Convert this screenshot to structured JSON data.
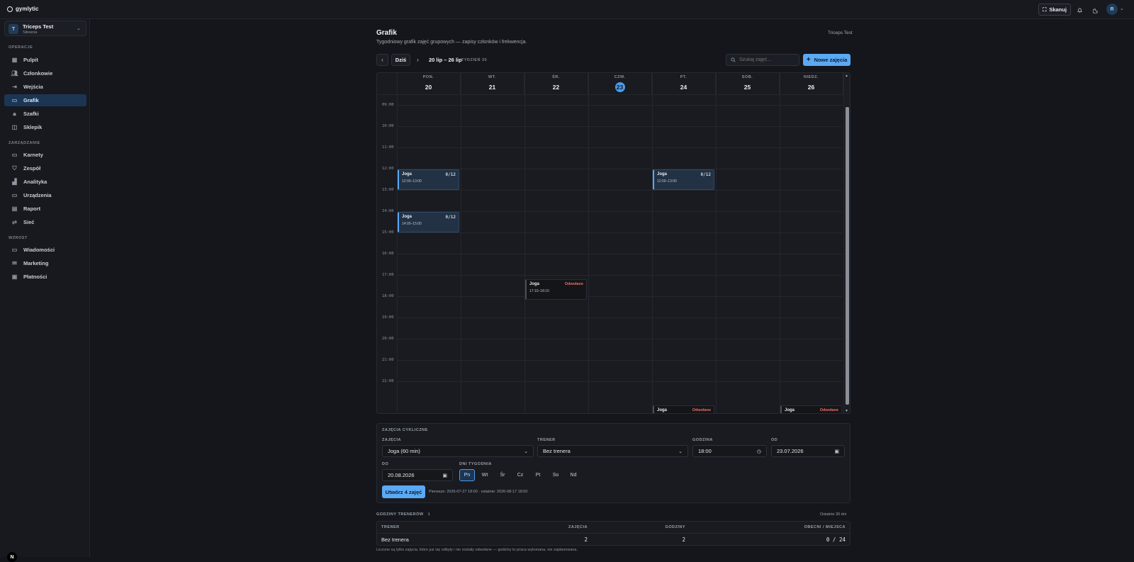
{
  "app": {
    "name": "gymlytic"
  },
  "topbar": {
    "scan_label": "Skanuj",
    "avatar_initial": "R"
  },
  "gym": {
    "initial": "T",
    "name": "Triceps Test",
    "type": "Siłownia"
  },
  "sidebar": {
    "sections": [
      {
        "title": "OPERACJE",
        "items": [
          {
            "label": "Pulpit",
            "icon": "grid-icon"
          },
          {
            "label": "Członkowie",
            "icon": "users-icon"
          },
          {
            "label": "Wejścia",
            "icon": "login-icon"
          },
          {
            "label": "Grafik",
            "icon": "calendar-icon",
            "active": true
          },
          {
            "label": "Szafki",
            "icon": "lock-icon"
          },
          {
            "label": "Sklepik",
            "icon": "bag-icon"
          }
        ]
      },
      {
        "title": "ZARZĄDZANIE",
        "items": [
          {
            "label": "Karnety",
            "icon": "card-icon"
          },
          {
            "label": "Zespół",
            "icon": "shield-icon"
          },
          {
            "label": "Analityka",
            "icon": "chart-icon"
          },
          {
            "label": "Urządzenia",
            "icon": "monitor-icon"
          },
          {
            "label": "Raport",
            "icon": "report-icon"
          },
          {
            "label": "Sieć",
            "icon": "network-icon"
          }
        ]
      },
      {
        "title": "WZROST",
        "items": [
          {
            "label": "Wiadomości",
            "icon": "message-icon"
          },
          {
            "label": "Marketing",
            "icon": "mail-icon"
          },
          {
            "label": "Płatności",
            "icon": "payment-icon"
          }
        ]
      }
    ]
  },
  "page": {
    "title": "Grafik",
    "subtitle": "Tygodniowy grafik zajęć grupowych — zapisy członków i frekwencja.",
    "org": "Triceps Test"
  },
  "toolbar": {
    "today_label": "Dziś",
    "range": "20 lip – 26 lip",
    "week": "TYDZIEŃ 30",
    "search_placeholder": "Szukaj zajęć...",
    "new_label": "Nowe zajęcia"
  },
  "calendar": {
    "days": [
      {
        "dow": "PON.",
        "num": "20"
      },
      {
        "dow": "WT.",
        "num": "21"
      },
      {
        "dow": "ŚR.",
        "num": "22"
      },
      {
        "dow": "CZW.",
        "num": "23",
        "today": true
      },
      {
        "dow": "PT.",
        "num": "24"
      },
      {
        "dow": "SOB.",
        "num": "25"
      },
      {
        "dow": "NIEDZ.",
        "num": "26"
      }
    ],
    "hours": [
      "09:00",
      "10:00",
      "11:00",
      "12:00",
      "13:00",
      "14:00",
      "15:00",
      "16:00",
      "17:00",
      "18:00",
      "19:00",
      "20:00",
      "21:00",
      "22:00"
    ],
    "events": [
      {
        "day": 0,
        "start": 12,
        "end": 13,
        "name": "Joga",
        "time": "12:00–13:00",
        "count": "0/12",
        "cancelled": false
      },
      {
        "day": 0,
        "start": 14,
        "end": 15,
        "name": "Joga",
        "time": "14:00–15:00",
        "count": "0/12",
        "cancelled": false
      },
      {
        "day": 4,
        "start": 12,
        "end": 13,
        "name": "Joga",
        "time": "12:00–13:00",
        "count": "0/12",
        "cancelled": false
      },
      {
        "day": 2,
        "start": 17.17,
        "end": 18.17,
        "name": "Joga",
        "time": "17:10–18:10",
        "status": "Odwołane",
        "cancelled": true
      },
      {
        "day": 4,
        "start": 23.1,
        "end": 23.6,
        "name": "Joga",
        "time": "",
        "status": "Odwołane",
        "cancelled": true
      },
      {
        "day": 6,
        "start": 23.1,
        "end": 23.6,
        "name": "Joga",
        "time": "",
        "status": "Odwołane",
        "cancelled": true
      }
    ]
  },
  "cyclic": {
    "title": "ZAJĘCIA CYKLICZNE",
    "class_label": "ZAJĘCIA",
    "class_value": "Joga (60 min)",
    "trainer_label": "TRENER",
    "trainer_value": "Bez trenera",
    "hour_label": "GODZINA",
    "hour_value": "18:00",
    "from_label": "OD",
    "from_value": "23.07.2026",
    "to_label": "DO",
    "to_value": "20.08.2026",
    "days_label": "DNI TYGODNIA",
    "weekdays": [
      {
        "label": "Pn",
        "selected": true
      },
      {
        "label": "Wt",
        "selected": false
      },
      {
        "label": "Śr",
        "selected": false
      },
      {
        "label": "Cz",
        "selected": false
      },
      {
        "label": "Pt",
        "selected": false
      },
      {
        "label": "So",
        "selected": false
      },
      {
        "label": "Nd",
        "selected": false
      }
    ],
    "create_label": "Utwórz 4 zajęć",
    "hint": "Pierwsze: 2026-07-27 18:00 · ostatnie: 2026-08-17 18:00"
  },
  "trainers": {
    "title": "GODZINY TRENERÓW",
    "count": "1",
    "period": "Ostatnie 30 dni",
    "headers": [
      "TRENER",
      "ZAJĘCIA",
      "GODZINY",
      "OBECNI / MIEJSCA"
    ],
    "rows": [
      {
        "trainer": "Bez trenera",
        "classes": "2",
        "hours": "2",
        "attendance": "0 / 24"
      }
    ],
    "footnote": "Liczone są tylko zajęcia, które już się odbyły i nie zostały odwołane — godziny to praca wykonana, nie zaplanowana."
  },
  "colors": {
    "accent": "#5aa9f5",
    "cancelled": "#ef6b6b",
    "background": "#14161b"
  }
}
